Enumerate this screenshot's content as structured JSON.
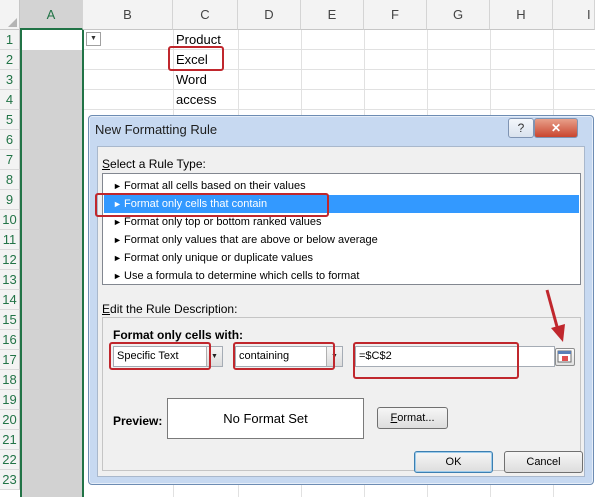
{
  "sheet": {
    "columns": [
      "A",
      "B",
      "C",
      "D",
      "E",
      "F",
      "G",
      "H",
      "I"
    ],
    "rows": [
      "1",
      "2",
      "3",
      "4",
      "5",
      "6",
      "7",
      "8",
      "9",
      "10",
      "11",
      "12",
      "13",
      "14",
      "15",
      "16",
      "17",
      "18",
      "19",
      "20",
      "21",
      "22",
      "23"
    ],
    "cells": {
      "c1": "Product",
      "c2": "Excel",
      "c3": "Word",
      "c4": "access"
    },
    "dropdown_icon": "filter-dropdown-icon"
  },
  "dialog": {
    "title": "New Formatting Rule",
    "help_label": "?",
    "close_label": "✕",
    "rule_type_label_pre": "",
    "rule_type_label_u": "S",
    "rule_type_label_post": "elect a Rule Type:",
    "rule_types": [
      "Format all cells based on their values",
      "Format only cells that contain",
      "Format only top or bottom ranked values",
      "Format only values that are above or below average",
      "Format only unique or duplicate values",
      "Use a formula to determine which cells to format"
    ],
    "selected_rule_index": 1,
    "edit_label_u": "E",
    "edit_label_post": "dit the Rule Description:",
    "format_only_label": "Format only cells with:",
    "condition_type": "Specific Text",
    "operator": "containing",
    "value": "=$C$2",
    "preview_label": "Preview:",
    "preview_text": "No Format Set",
    "format_button_u": "F",
    "format_button_post": "ormat...",
    "ok_label": "OK",
    "cancel_label": "Cancel"
  },
  "colors": {
    "excel_green": "#217346",
    "selection_blue": "#3399ff",
    "annotation_red": "#c0272d"
  }
}
